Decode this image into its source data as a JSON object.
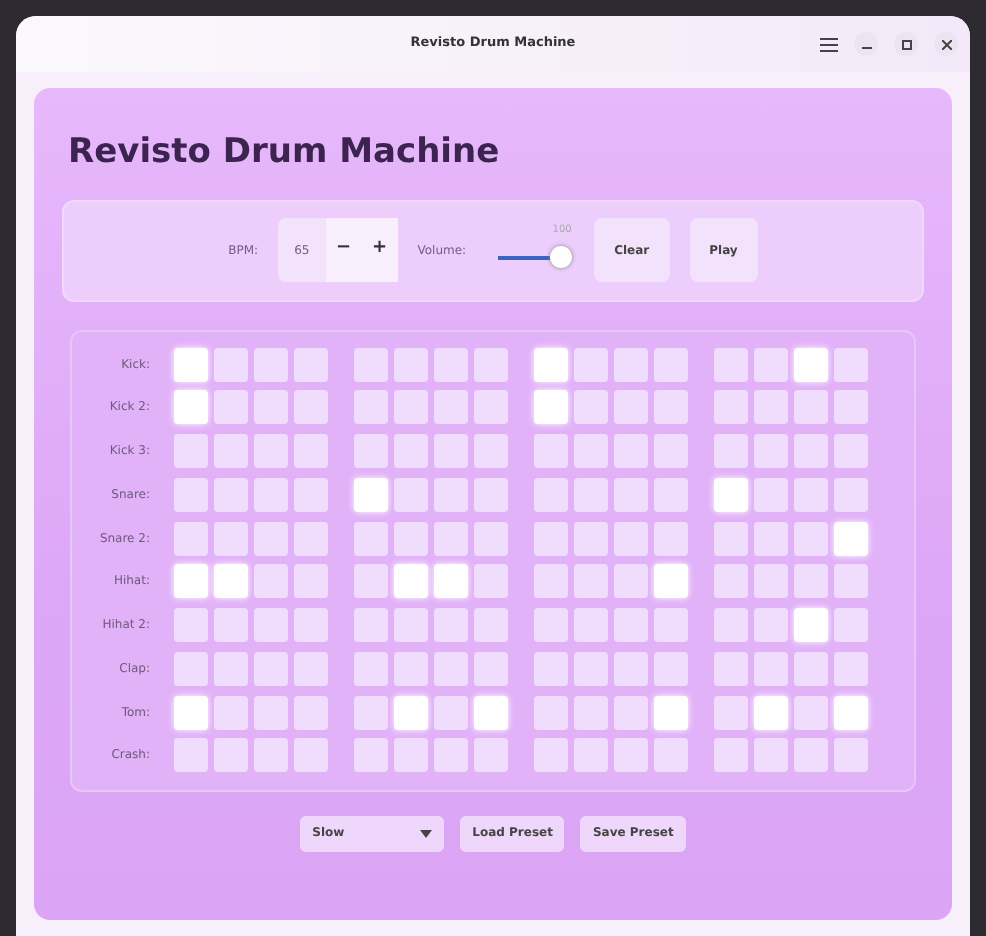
{
  "window": {
    "title": "Revisto Drum Machine"
  },
  "heading": "Revisto Drum Machine",
  "controls": {
    "bpm": {
      "label": "BPM:",
      "value": "65",
      "decrement": "−",
      "increment": "+"
    },
    "volume": {
      "label": "Volume:",
      "level": 1,
      "reading": "100"
    },
    "buttons": [
      "Clear",
      "Play"
    ]
  },
  "tracks": [
    {
      "name": "Kick:",
      "steps": [
        true,
        false,
        false,
        false,
        false,
        false,
        false,
        false,
        true,
        false,
        false,
        false,
        false,
        false,
        true,
        false
      ]
    },
    {
      "name": "Kick 2:",
      "steps": [
        true,
        false,
        false,
        false,
        false,
        false,
        false,
        false,
        true,
        false,
        false,
        false,
        false,
        false,
        false,
        false
      ]
    },
    {
      "name": "Kick 3:",
      "steps": [
        false,
        false,
        false,
        false,
        false,
        false,
        false,
        false,
        false,
        false,
        false,
        false,
        false,
        false,
        false,
        false
      ]
    },
    {
      "name": "Snare:",
      "steps": [
        false,
        false,
        false,
        false,
        true,
        false,
        false,
        false,
        false,
        false,
        false,
        false,
        true,
        false,
        false,
        false
      ]
    },
    {
      "name": "Snare 2:",
      "steps": [
        false,
        false,
        false,
        false,
        false,
        false,
        false,
        false,
        false,
        false,
        false,
        false,
        false,
        false,
        false,
        true
      ]
    },
    {
      "name": "Hihat:",
      "steps": [
        true,
        true,
        false,
        false,
        false,
        true,
        true,
        false,
        false,
        false,
        false,
        true,
        false,
        false,
        false,
        false
      ]
    },
    {
      "name": "Hihat 2:",
      "steps": [
        false,
        false,
        false,
        false,
        false,
        false,
        false,
        false,
        false,
        false,
        false,
        false,
        false,
        false,
        true,
        false
      ]
    },
    {
      "name": "Clap:",
      "steps": [
        false,
        false,
        false,
        false,
        false,
        false,
        false,
        false,
        false,
        false,
        false,
        false,
        false,
        false,
        false,
        false
      ]
    },
    {
      "name": "Tom:",
      "steps": [
        true,
        false,
        false,
        false,
        false,
        true,
        false,
        true,
        false,
        false,
        false,
        true,
        false,
        true,
        false,
        true
      ]
    },
    {
      "name": "Crash:",
      "steps": [
        false,
        false,
        false,
        false,
        false,
        false,
        false,
        false,
        false,
        false,
        false,
        false,
        false,
        false,
        false,
        false
      ]
    }
  ],
  "footer": {
    "preset": "Slow",
    "buttons": [
      "Load Preset",
      "Save Preset"
    ]
  }
}
